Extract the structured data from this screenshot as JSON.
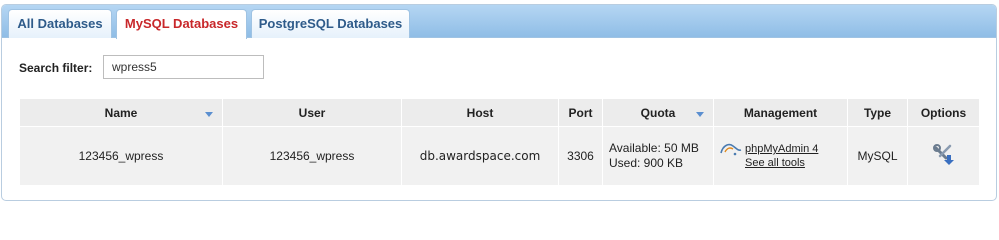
{
  "tabs": [
    {
      "label": "All Databases",
      "active": false
    },
    {
      "label": "MySQL Databases",
      "active": true
    },
    {
      "label": "PostgreSQL Databases",
      "active": false
    }
  ],
  "search": {
    "label": "Search filter:",
    "value": "wpress5"
  },
  "table": {
    "headers": [
      "Name",
      "User",
      "Host",
      "Port",
      "Quota",
      "Management",
      "Type",
      "Options"
    ],
    "row": {
      "name": "123456_wpress",
      "user": "123456_wpress",
      "host": "db.awardspace.com",
      "port": "3306",
      "quota_available": "Available: 50 MB",
      "quota_used": "Used: 900 KB",
      "mgmt_link": "phpMyAdmin 4",
      "mgmt_tools": "See all tools",
      "type": "MySQL",
      "options_icon": "tools-download-icon"
    }
  },
  "colors": {
    "active_tab_text": "#c8272a",
    "tab_text": "#2e5b8a",
    "tabbar_top": "#b5d6f3",
    "tabbar_bottom": "#8fbde6",
    "sort_arrow": "#5b8fd0"
  }
}
